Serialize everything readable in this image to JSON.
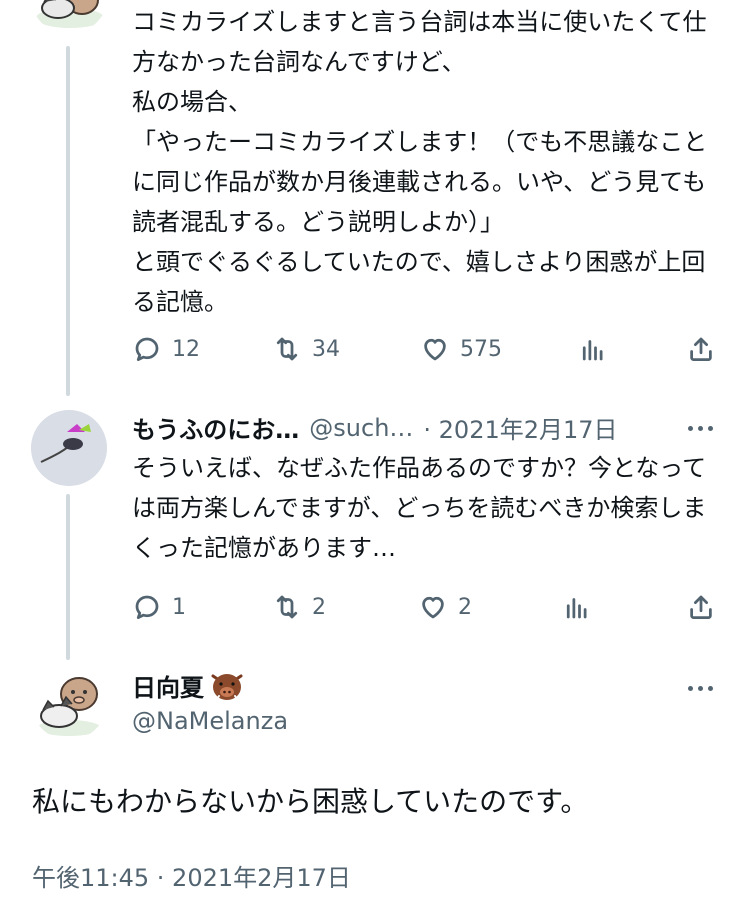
{
  "tweet1": {
    "text": "コミカライズしますと言う台詞は本当に使いたくて仕方なかった台詞なんですけど、\n私の場合、\n「やったーコミカライズします！（でも不思議なことに同じ作品が数か月後連載される。いや、どう見ても読者混乱する。どう説明しよか）」\nと頭でぐるぐるしていたので、嬉しさより困惑が上回る記憶。",
    "actions": {
      "replies": "12",
      "retweets": "34",
      "likes": "575"
    }
  },
  "tweet2": {
    "name": "もうふのにお…",
    "handle": "@such…",
    "date": "· 2021年2月17日",
    "text": "そういえば、なぜふた作品あるのですか？今となっては両方楽しんでますが、どっちを読むべきか検索しまくった記憶があります…",
    "actions": {
      "replies": "1",
      "retweets": "2",
      "likes": "2"
    }
  },
  "main_tweet": {
    "name": "日向夏",
    "handle": "@NaMelanza",
    "text": "私にもわからないから困惑していたのです。",
    "timestamp": "午後11:45 · 2021年2月17日"
  },
  "icons": [
    "reply-icon",
    "retweet-icon",
    "like-icon",
    "views-icon",
    "share-icon",
    "more-icon",
    "boar-emoji-icon"
  ],
  "colors": {
    "text": "#0f1419",
    "secondary": "#536471",
    "thread_line": "#cfd9de"
  }
}
